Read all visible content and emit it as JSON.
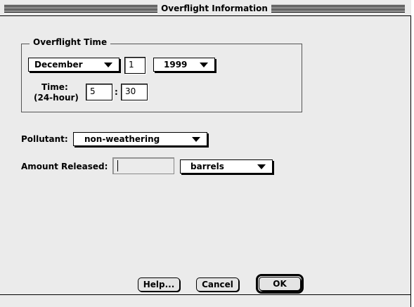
{
  "window": {
    "title": "Overflight Information"
  },
  "overflight_time": {
    "group_title": "Overflight Time",
    "month": "December",
    "day": "1",
    "year": "1999",
    "time_label_line1": "Time:",
    "time_label_line2": "(24-hour)",
    "hour": "5",
    "colon": ":",
    "minute": "30"
  },
  "pollutant": {
    "label": "Pollutant:",
    "value": "non-weathering"
  },
  "amount": {
    "label": "Amount Released:",
    "value": "",
    "unit": "barrels"
  },
  "buttons": {
    "help": "Help...",
    "cancel": "Cancel",
    "ok": "OK"
  }
}
